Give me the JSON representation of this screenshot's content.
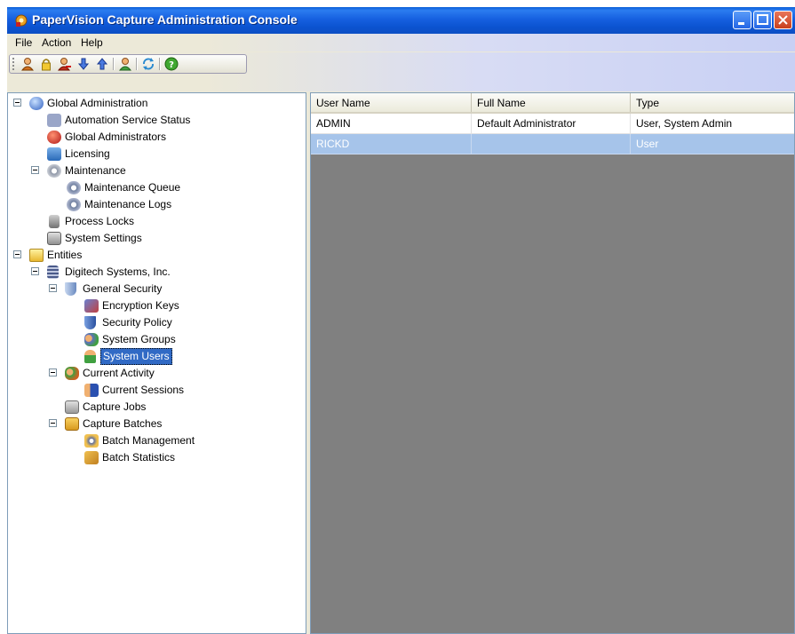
{
  "window": {
    "title": "PaperVision Capture Administration Console",
    "icon": "app-gear-icon"
  },
  "menu": {
    "file": "File",
    "action": "Action",
    "help": "Help"
  },
  "toolbar": {
    "icons": [
      "add-user-icon",
      "lock-icon",
      "remove-user-icon",
      "move-down-icon",
      "move-up-icon",
      "user-properties-icon",
      "refresh-icon",
      "help-icon"
    ]
  },
  "tree": {
    "global_administration": "Global Administration",
    "automation_service_status": "Automation Service Status",
    "global_administrators": "Global Administrators",
    "licensing": "Licensing",
    "maintenance": "Maintenance",
    "maintenance_queue": "Maintenance Queue",
    "maintenance_logs": "Maintenance Logs",
    "process_locks": "Process Locks",
    "system_settings": "System Settings",
    "entities": "Entities",
    "digitech": "Digitech Systems, Inc.",
    "general_security": "General Security",
    "encryption_keys": "Encryption Keys",
    "security_policy": "Security Policy",
    "system_groups": "System Groups",
    "system_users": "System Users",
    "current_activity": "Current Activity",
    "current_sessions": "Current Sessions",
    "capture_jobs": "Capture Jobs",
    "capture_batches": "Capture Batches",
    "batch_management": "Batch Management",
    "batch_statistics": "Batch Statistics"
  },
  "grid": {
    "columns": [
      "User Name",
      "Full Name",
      "Type"
    ],
    "rows": [
      {
        "user_name": "ADMIN",
        "full_name": "Default Administrator",
        "type": "User, System Admin"
      },
      {
        "user_name": "RICKD",
        "full_name": "",
        "type": "User"
      }
    ]
  },
  "colors": {
    "titlebar": "#0b53d0",
    "selection": "#316ac5",
    "row_selected": "#a6c4ea",
    "empty_area": "#808080"
  }
}
